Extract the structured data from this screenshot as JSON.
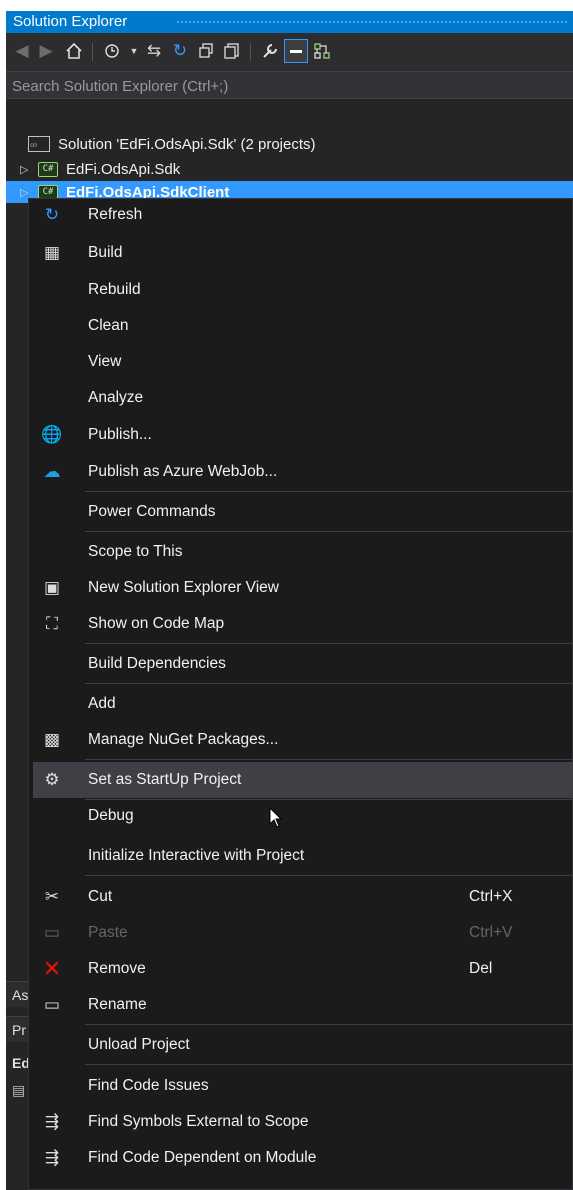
{
  "panel": {
    "title": "Solution Explorer"
  },
  "toolbar": {
    "buttons": [
      {
        "icon": "back-icon",
        "glyph": "◉"
      },
      {
        "icon": "forward-icon",
        "glyph": "◉"
      },
      {
        "icon": "home-icon",
        "glyph": "⌂"
      },
      {
        "icon": "pending-changes-icon",
        "glyph": "↻"
      },
      {
        "icon": "sync-icon",
        "glyph": "⇆"
      },
      {
        "icon": "refresh-icon",
        "glyph": "↻"
      },
      {
        "icon": "collapse-all-icon",
        "glyph": "⧉"
      },
      {
        "icon": "show-all-files-icon",
        "glyph": "▤"
      },
      {
        "icon": "properties-icon",
        "glyph": "🔧"
      },
      {
        "icon": "preview-selected-icon",
        "glyph": "▬"
      },
      {
        "icon": "code-map-icon",
        "glyph": "⛶"
      }
    ]
  },
  "search": {
    "placeholder": "Search Solution Explorer (Ctrl+;)"
  },
  "tree": {
    "solution": "Solution 'EdFi.OdsApi.Sdk' (2 projects)",
    "projects": [
      {
        "label": "EdFi.OdsApi.Sdk",
        "icon_text": "C#",
        "selected": false
      },
      {
        "label": "EdFi.OdsApi.SdkClient",
        "icon_text": "C#",
        "selected": true
      }
    ]
  },
  "background_fragments": {
    "tab_as": "As",
    "tab_pr": "Pr",
    "header_ed": "Ed"
  },
  "menu": {
    "items": [
      {
        "label": "Refresh",
        "icon": "refresh-icon",
        "glyph": "↻",
        "shortcut": ""
      },
      {
        "label": "Build",
        "icon": "build-icon",
        "glyph": "▦",
        "shortcut": ""
      },
      {
        "label": "Rebuild",
        "icon": "",
        "glyph": "",
        "shortcut": ""
      },
      {
        "label": "Clean",
        "icon": "",
        "glyph": "",
        "shortcut": ""
      },
      {
        "label": "View",
        "icon": "",
        "glyph": "",
        "shortcut": ""
      },
      {
        "label": "Analyze",
        "icon": "",
        "glyph": "",
        "shortcut": ""
      },
      {
        "label": "Publish...",
        "icon": "publish-globe-icon",
        "glyph": "🌐",
        "shortcut": ""
      },
      {
        "label": "Publish as Azure WebJob...",
        "icon": "azure-webjob-icon",
        "glyph": "☁",
        "shortcut": ""
      },
      {
        "label": "Power Commands",
        "icon": "",
        "glyph": "",
        "shortcut": ""
      },
      {
        "label": "Scope to This",
        "icon": "",
        "glyph": "",
        "shortcut": ""
      },
      {
        "label": "New Solution Explorer View",
        "icon": "new-view-icon",
        "glyph": "▣",
        "shortcut": ""
      },
      {
        "label": "Show on Code Map",
        "icon": "code-map-icon",
        "glyph": "⛶",
        "shortcut": ""
      },
      {
        "label": "Build Dependencies",
        "icon": "",
        "glyph": "",
        "shortcut": ""
      },
      {
        "label": "Add",
        "icon": "",
        "glyph": "",
        "shortcut": ""
      },
      {
        "label": "Manage NuGet Packages...",
        "icon": "nuget-icon",
        "glyph": "▩",
        "shortcut": ""
      },
      {
        "label": "Set as StartUp Project",
        "icon": "gear-icon",
        "glyph": "⚙",
        "shortcut": ""
      },
      {
        "label": "Debug",
        "icon": "",
        "glyph": "",
        "shortcut": ""
      },
      {
        "label": "Initialize Interactive with Project",
        "icon": "",
        "glyph": "",
        "shortcut": ""
      },
      {
        "label": "Cut",
        "icon": "scissors-icon",
        "glyph": "✂",
        "shortcut": "Ctrl+X"
      },
      {
        "label": "Paste",
        "icon": "paste-icon",
        "glyph": "▭",
        "shortcut": "Ctrl+V"
      },
      {
        "label": "Remove",
        "icon": "remove-x-icon",
        "glyph": "✕",
        "shortcut": "Del"
      },
      {
        "label": "Rename",
        "icon": "rename-icon",
        "glyph": "▭",
        "shortcut": ""
      },
      {
        "label": "Unload Project",
        "icon": "",
        "glyph": "",
        "shortcut": ""
      },
      {
        "label": "Find Code Issues",
        "icon": "",
        "glyph": "",
        "shortcut": ""
      },
      {
        "label": "Find Symbols External to Scope",
        "icon": "find-symbols-icon",
        "glyph": "⇶",
        "shortcut": ""
      },
      {
        "label": "Find Code Dependent on Module",
        "icon": "find-dependent-icon",
        "glyph": "⇶",
        "shortcut": ""
      }
    ]
  },
  "colors": {
    "accent": "#007acc",
    "selection": "#3399ff",
    "menu_bg": "#1b1b1c",
    "hover": "#3f3f46",
    "remove_red": "#e51400",
    "azure_blue": "#1ba1e2"
  }
}
